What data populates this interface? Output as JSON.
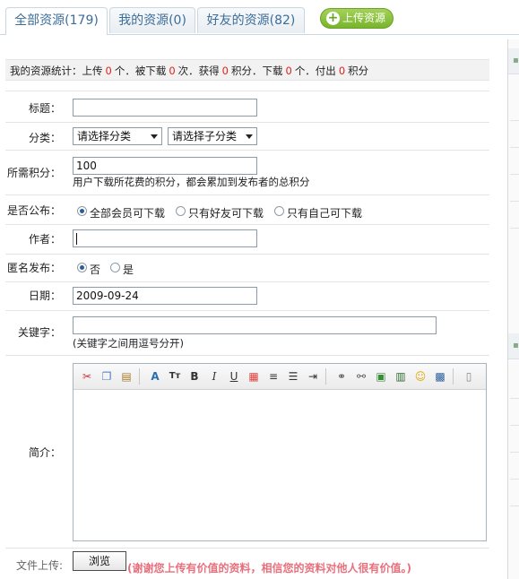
{
  "tabs": [
    {
      "label": "全部资源(179)"
    },
    {
      "label": "我的资源(0)"
    },
    {
      "label": "好友的资源(82)"
    }
  ],
  "upload_button": {
    "label": "上传资源"
  },
  "stats": {
    "prefix": "我的资源统计：上传",
    "uploads": "0",
    "t1": "个．被下载",
    "downloaded": "0",
    "t2": "次．获得",
    "earned": "0",
    "t3": "积分．下载",
    "downloads": "0",
    "t4": "个．付出",
    "paid": "0",
    "t5": "积分"
  },
  "form": {
    "title_label": "标题：",
    "title_value": "",
    "category_label": "分类：",
    "category_select": "请选择分类",
    "subcategory_select": "请选择子分类",
    "points_label": "所需积分：",
    "points_value": "100",
    "points_hint": "用户下载所花费的积分，都会累加到发布者的总积分",
    "public_label": "是否公布：",
    "public_options": [
      {
        "label": "全部会员可下载",
        "checked": true
      },
      {
        "label": "只有好友可下载",
        "checked": false
      },
      {
        "label": "只有自己可下载",
        "checked": false
      }
    ],
    "author_label": "作者：",
    "author_value": "",
    "anonymous_label": "匿名发布：",
    "anonymous_options": [
      {
        "label": "否",
        "checked": true
      },
      {
        "label": "是",
        "checked": false
      }
    ],
    "date_label": "日期：",
    "date_value": "2009-09-24",
    "keywords_label": "关键字：",
    "keywords_value": "",
    "keywords_hint": "(关键字之间用逗号分开)",
    "intro_label": "简介：",
    "file_label": "文件上传:",
    "browse_label": "浏览",
    "thanks_text": "(谢谢您上传有价值的资料，相信您的资料对他人很有价值。)"
  },
  "editor_toolbar": [
    "cut-icon",
    "copy-icon",
    "paste-icon",
    "font-color-icon",
    "font-size-icon",
    "bold-icon",
    "italic-icon",
    "underline-icon",
    "color-grid-icon",
    "align-icon",
    "list-icon",
    "indent-icon",
    "link-icon",
    "unlink-icon",
    "image-icon",
    "media-icon",
    "emoticon-icon",
    "save-icon",
    "page-icon"
  ],
  "colors": {
    "tab_text": "#3b6d99",
    "accent_green": "#78b42c",
    "stat_number": "#e0201c",
    "thanks_text": "#e8707d",
    "radio_dot": "#2a5d9a"
  }
}
